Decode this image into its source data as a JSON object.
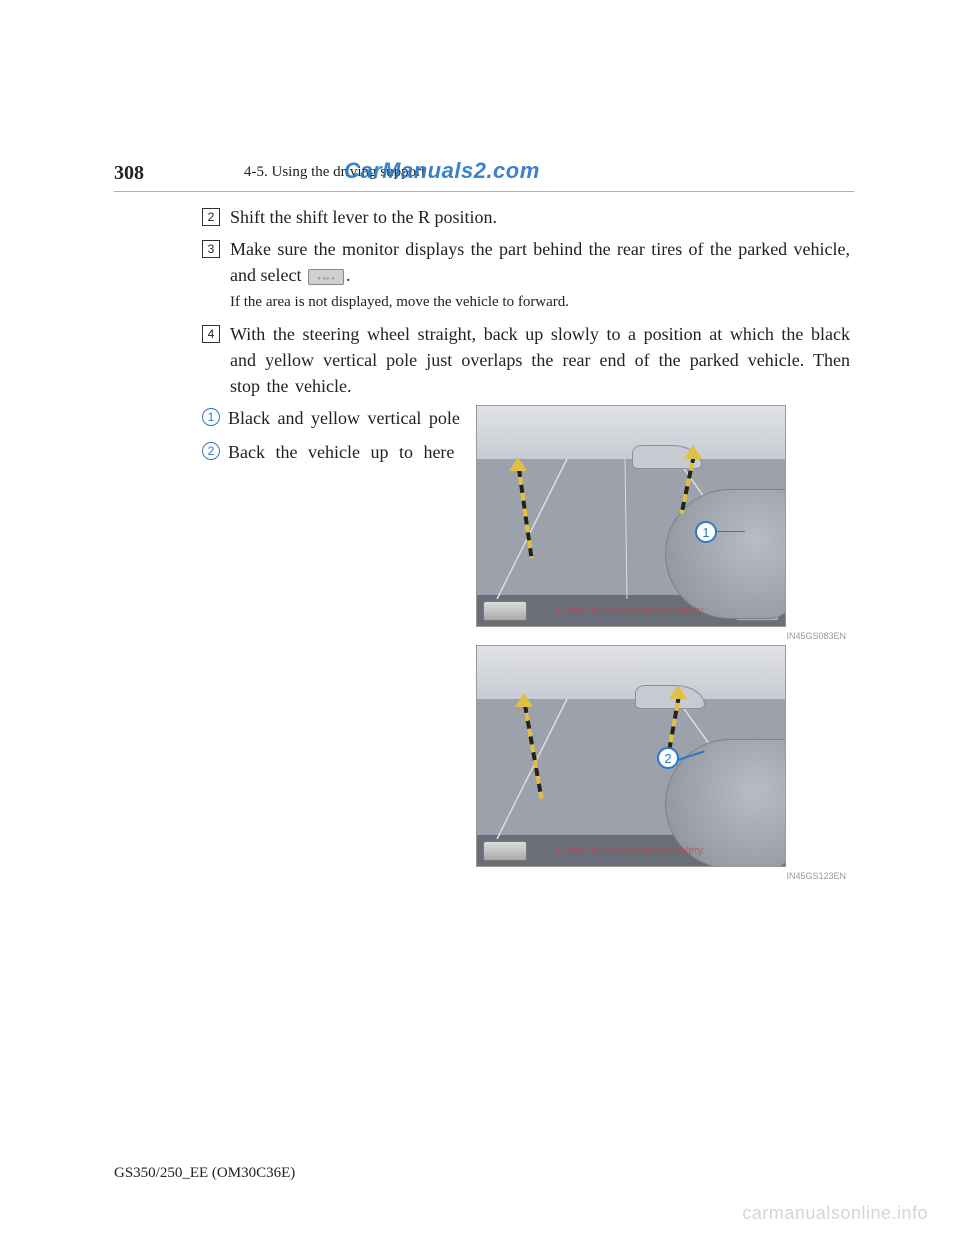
{
  "header": {
    "page_number": "308",
    "section": "4-5. Using the driving support",
    "watermark": "CarManuals2.com"
  },
  "steps": [
    {
      "num": "2",
      "text": "Shift the shift lever to the R position."
    },
    {
      "num": "3",
      "text": "Make sure the monitor displays the part behind the rear tires of the parked vehicle, and select ",
      "text_after": ".",
      "note": "If the area is not displayed, move the vehicle to forward."
    },
    {
      "num": "4",
      "text": "With the steering wheel straight, back up slowly to a position at which the black and yellow vertical pole just overlaps the rear end of the parked vehicle. Then stop the vehicle."
    }
  ],
  "labels": [
    {
      "num": "1",
      "text": "Black and yellow vertical pole"
    },
    {
      "num": "2",
      "text": "Back the vehicle up to here"
    }
  ],
  "screens": {
    "bar_text": "Check surroundings for safety.",
    "caption1": "IN45GS083EN",
    "caption2": "IN45GS123EN",
    "callout1": "1",
    "callout2": "2"
  },
  "footer": {
    "code": "GS350/250_EE (OM30C36E)",
    "watermark": "carmanualsonline.info"
  }
}
